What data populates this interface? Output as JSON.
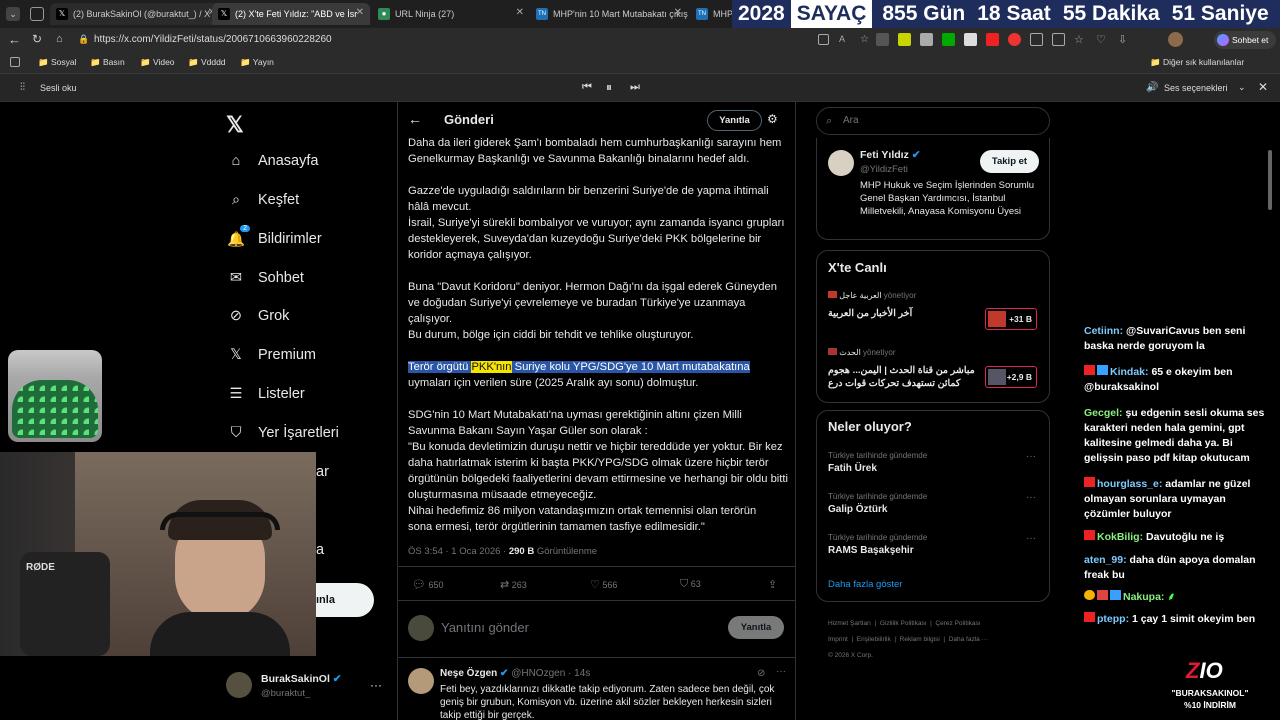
{
  "browser": {
    "tabs": [
      {
        "label": "(2) BurakSakinOl (@buraktut_) / X"
      },
      {
        "label": "(2) X'te Feti Yıldız: \"ABD ve İsr"
      },
      {
        "label": "URL Ninja (27)"
      },
      {
        "label": "MHP'nin 10 Mart Mutabakatı çıkışı"
      },
      {
        "label": "MHP'"
      }
    ],
    "url": "https://x.com/YildizFeti/status/2006710663960228260",
    "bookmarks": [
      "Sosyal",
      "Basın",
      "Video",
      "Vdddd",
      "Yayın"
    ],
    "other_bookmarks": "Diğer sık kullanılanlar",
    "read_aloud": "Sesli oku",
    "voice_options": "Ses seçenekleri",
    "profile_label": "Sohbet et"
  },
  "counter": {
    "year": "2028",
    "title": "SAYAÇ",
    "days": "855 Gün",
    "hours": "18 Saat",
    "minutes": "55 Dakika",
    "seconds": "51 Saniye"
  },
  "nav": {
    "items": [
      "Anasayfa",
      "Keşfet",
      "Bildirimler",
      "Sohbet",
      "Grok",
      "Premium",
      "Listeler",
      "Yer İşaretleri"
    ],
    "notif_badge": "2",
    "partial_1": "ar",
    "partial_2": "a",
    "post_button": "ınla",
    "account_name": "BurakSakinOl",
    "account_handle": "@buraktut_"
  },
  "post": {
    "header": "Gönderi",
    "reply_btn": "Yanıtla",
    "p1": "Daha da ileri giderek Şam'ı bombaladı hem cumhurbaşkanlığı sarayını hem Genelkurmay Başkanlığı ve Savunma Bakanlığı binalarını hedef aldı.",
    "p2a": "Gazze'de uyguladığı saldırıların bir benzerini Suriye'de de yapma ihtimali hâlâ mevcut.",
    "p2b": "İsrail, Suriye'yi sürekli bombalıyor ve vuruyor; aynı zamanda isyancı grupları destekleyerek, Suveyda'dan kuzeydoğu Suriye'deki PKK bölgelerine bir koridor açmaya çalışıyor.",
    "p3a": "Buna \"Davut Koridoru\" deniyor. Hermon Dağı'nı da işgal ederek Güneyden ve doğudan Suriye'yi çevrelemeye ve buradan Türkiye'ye uzanmaya çalışıyor.",
    "p3b": "Bu durum, bölge için ciddi bir tehdit ve tehlike oluşturuyor.",
    "sel1": "Terör örgütü ",
    "sel_pkk": "PKK'nın",
    "sel2": " Suriye kolu YPG/SDG'ye 10 Mart mutabakatına",
    "p4rest": "uymaları için verilen süre (2025 Aralık ayı sonu) dolmuştur.",
    "p5": "SDG'nin 10 Mart Mutabakatı'na uyması gerektiğinin altını çizen Milli Savunma Bakanı Sayın Yaşar Güler son olarak :",
    "p6": "\"Bu konuda devletimizin duruşu nettir ve hiçbir tereddüde yer yoktur. Bir kez daha hatırlatmak isterim ki başta PKK/YPG/SDG olmak üzere hiçbir terör örgütünün bölgedeki faaliyetlerini devam ettirmesine ve herhangi bir oldu bitti oluşturmasına müsaade etmeyeceğiz.",
    "p7": "Nihai hedefimiz 86 milyon vatandaşımızın ortak temennisi olan terörün sona ermesi, terör örgütlerinin tamamen tasfiye edilmesidir.\"",
    "time": "ÖS 3:54 · 1 Oca 2026 · ",
    "views": "290 B",
    "views_label": " Görüntülenme",
    "replies": "650",
    "reposts": "263",
    "likes": "566",
    "bookmarks": "63",
    "reply_placeholder": "Yanıtını gönder",
    "reply_submit": "Yanıtla"
  },
  "reply_tweet": {
    "name": "Neşe Özgen",
    "handle": "@HNOzgen · 14s",
    "text": "Feti bey, yazdıklarınızı dikkatle takip ediyorum. Zaten sadece ben değil, çok geniş bir grubun, Komisyon vb. üzerine akil sözler bekleyen herkesin sizleri takip ettiği bir gerçek."
  },
  "right": {
    "search_placeholder": "Ara",
    "profile": {
      "name": "Feti Yıldız",
      "handle": "@YildizFeti",
      "follow": "Takip et",
      "bio": "MHP Hukuk ve Seçim İşlerinden Sorumlu Genel Başkan Yardımcısı, İstanbul Milletvekili, Anayasa Komisyonu Üyesi"
    },
    "live_title": "X'te Canlı",
    "live": [
      {
        "source": "العربية عاجل",
        "status": "yönetiyor",
        "title": "آخر الأخبار من العربية",
        "count": "+31 B",
        "color": "#c0392b"
      },
      {
        "source": "الحدث",
        "status": "yönetiyor",
        "title": "مباشر من قناة الحدث | اليمن... هجوم كمائن تستهدف تحركات قوات درع",
        "count": "+2,9 B",
        "color": "#c0392b"
      }
    ],
    "trends_title": "Neler oluyor?",
    "trends": [
      {
        "sub": "Türkiye tarihinde gündemde",
        "main": "Fatih Ürek"
      },
      {
        "sub": "Türkiye tarihinde gündemde",
        "main": "Galip Öztürk"
      },
      {
        "sub": "Türkiye tarihinde gündemde",
        "main": "RAMS Başakşehir"
      }
    ],
    "more": "Daha fazla göster",
    "footer1": [
      "Hizmet Şartları",
      "Gizlilik Politikası",
      "Çerez Politikası"
    ],
    "footer2": [
      "Imprint",
      "Erişilebilirlik",
      "Reklam bilgisi",
      "Daha fazla ···"
    ],
    "copyright": "© 2026 X Corp."
  },
  "chat": [
    {
      "user": "Cetiinn:",
      "text": "@SuvariCavus ben seni baska nerde goruyom la",
      "color": "u"
    },
    {
      "user": "",
      "text": "65 e okeyim ben @buraksakinol",
      "color": "r"
    },
    {
      "user": "Gecgel:",
      "text": "şu edgenin sesli okuma ses karakteri neden hala gemini, gpt kalitesine gelmedi daha ya. Bi gelişsin paso pdf kitap okutucam",
      "color": "g"
    },
    {
      "user": "hourglass_e:",
      "text": "adamlar ne güzel olmayan sorunlara uymayan çözümler buluyor",
      "color": "u"
    },
    {
      "user": "KokBilig:",
      "text": "Davutoğlu ne iş",
      "color": "g"
    },
    {
      "user": "aten_99:",
      "text": "daha dün apoya domalan freak bu",
      "color": "u"
    },
    {
      "user": "Nakupa:",
      "text": "",
      "color": "g"
    },
    {
      "user": "ptepp:",
      "text": "1 çay 1 simit okeyim ben",
      "color": "u"
    }
  ],
  "chat_kindak": "Kindak:",
  "promo": {
    "code": "\"BURAKSAKINOL\"",
    "discount": "%10 İNDİRİM"
  },
  "rode": "RØDE"
}
